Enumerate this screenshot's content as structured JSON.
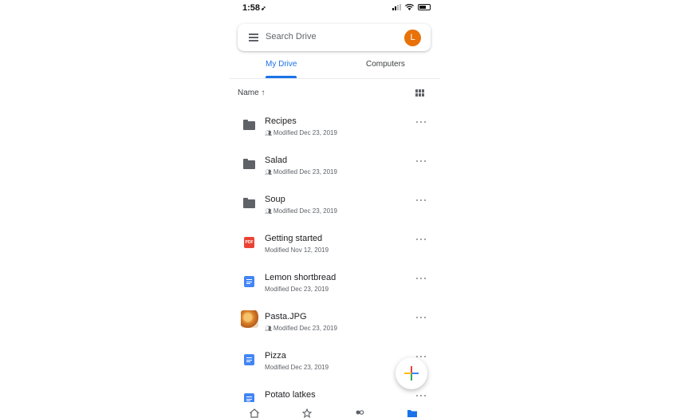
{
  "status_bar": {
    "time": "1:58",
    "location_arrow": "➶"
  },
  "search": {
    "placeholder": "Search Drive",
    "avatar_letter": "L",
    "avatar_color": "#e8710a"
  },
  "tabs": [
    {
      "label": "My Drive",
      "active": true
    },
    {
      "label": "Computers",
      "active": false
    }
  ],
  "sort": {
    "label": "Name ↑"
  },
  "files": [
    {
      "name": "Recipes",
      "modified": "Modified Dec 23, 2019",
      "type": "folder",
      "shared": true
    },
    {
      "name": "Salad",
      "modified": "Modified Dec 23, 2019",
      "type": "folder",
      "shared": true
    },
    {
      "name": "Soup",
      "modified": "Modified Dec 23, 2019",
      "type": "folder",
      "shared": true
    },
    {
      "name": "Getting started",
      "modified": "Modified Nov 12, 2019",
      "type": "pdf",
      "shared": false,
      "badge": "PDF"
    },
    {
      "name": "Lemon shortbread",
      "modified": "Modified Dec 23, 2019",
      "type": "doc",
      "shared": false
    },
    {
      "name": "Pasta.JPG",
      "modified": "Modified Dec 23, 2019",
      "type": "image",
      "shared": true
    },
    {
      "name": "Pizza",
      "modified": "Modified Dec 23, 2019",
      "type": "doc",
      "shared": false
    },
    {
      "name": "Potato latkes",
      "modified": "",
      "type": "doc",
      "shared": false
    }
  ],
  "fab": {
    "icon": "plus-icon",
    "colors": [
      "#ea4335",
      "#fbbc04",
      "#34a853",
      "#4285f4"
    ]
  },
  "bottom_nav": {
    "items": [
      "home-icon",
      "starred-icon",
      "shared-icon",
      "files-icon"
    ],
    "active": "files-icon",
    "active_color": "#1a73e8"
  },
  "colors": {
    "accent": "#1a73e8",
    "folder": "#5f6368",
    "pdf": "#ea4335",
    "doc": "#4285f4"
  }
}
